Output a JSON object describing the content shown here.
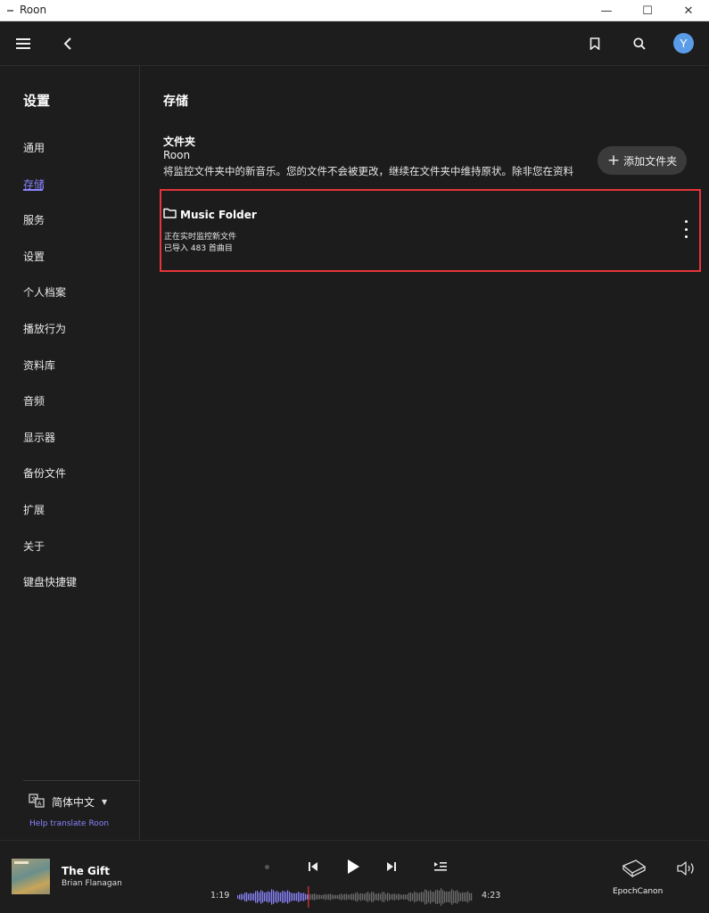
{
  "window": {
    "title": "Roon",
    "minimize_glyph": "—",
    "maximize_glyph": "☐",
    "close_glyph": "✕"
  },
  "topbar": {
    "icons": [
      "menu-icon",
      "back-icon",
      "bookmark-icon",
      "search-icon"
    ],
    "avatar_initial": "Y"
  },
  "sidebar": {
    "heading": "设置",
    "items": [
      {
        "label": "通用",
        "active": false
      },
      {
        "label": "存储",
        "active": true
      },
      {
        "label": "服务",
        "active": false
      },
      {
        "label": "设置",
        "active": false
      },
      {
        "label": "个人档案",
        "active": false
      },
      {
        "label": "播放行为",
        "active": false
      },
      {
        "label": "资料库",
        "active": false
      },
      {
        "label": "音频",
        "active": false
      },
      {
        "label": "显示器",
        "active": false
      },
      {
        "label": "备份文件",
        "active": false
      },
      {
        "label": "扩展",
        "active": false
      },
      {
        "label": "关于",
        "active": false
      },
      {
        "label": "键盘快捷键",
        "active": false
      }
    ],
    "language": "简体中文",
    "help_link": "Help translate Roon"
  },
  "main": {
    "title": "存储",
    "section_title": "文件夹",
    "section_sub": "Roon",
    "description": "将监控文件夹中的新音乐。您的文件不会被更改，继续在文件夹中维持原状。除非您在资料",
    "add_button": "添加文件夹",
    "folder": {
      "name": "Music Folder",
      "status": "正在实时监控新文件",
      "imported": "已导入 483 首曲目"
    }
  },
  "player": {
    "track_title": "The Gift",
    "artist": "Brian Flanagan",
    "elapsed": "1:19",
    "duration": "4:23",
    "zone_name": "EpochCanon",
    "progress_fraction": 0.3
  },
  "colors": {
    "accent": "#8a84ff",
    "highlight_border": "#e6343a",
    "avatar": "#5a9ce8",
    "background": "#1c1c1c"
  }
}
